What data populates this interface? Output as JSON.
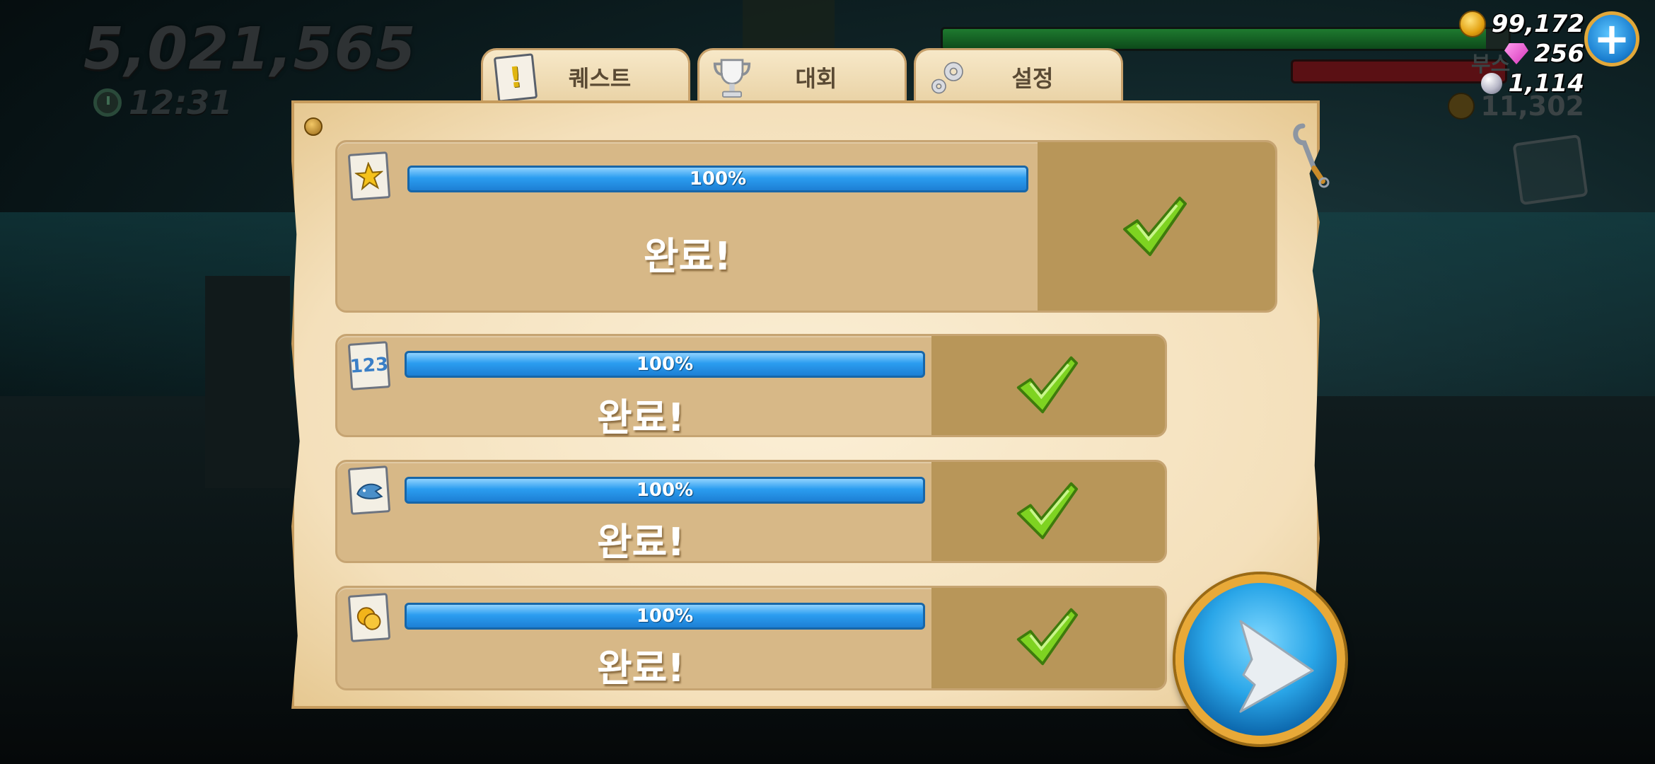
{
  "hud": {
    "score": "5,021,565",
    "timer": "12:31",
    "health_fraction": 0.96,
    "boost_label": "부스",
    "currencies": {
      "coins": "99,172",
      "gems": "256",
      "pearls": "1,114"
    },
    "secondary_coins": "11,302"
  },
  "tabs": [
    {
      "label": "퀘스트",
      "icon": "quest-exclamation-icon",
      "active": true
    },
    {
      "label": "대회",
      "icon": "trophy-icon",
      "active": false
    },
    {
      "label": "설정",
      "icon": "gear-icon",
      "active": false
    }
  ],
  "quests": [
    {
      "icon": "star-quest-icon",
      "progress_label": "100%",
      "progress": 1.0,
      "status": "완료!"
    },
    {
      "icon": "numbers-quest-icon",
      "progress_label": "100%",
      "progress": 1.0,
      "status": "완료!"
    },
    {
      "icon": "shark-quest-icon",
      "progress_label": "100%",
      "progress": 1.0,
      "status": "완료!"
    },
    {
      "icon": "coins-quest-icon",
      "progress_label": "100%",
      "progress": 1.0,
      "status": "완료!"
    }
  ],
  "colors": {
    "progress_blue": "#2b9df0",
    "check_green": "#7ed321",
    "panel_parchment": "#f4e0bb",
    "play_ring": "#e8a938"
  }
}
